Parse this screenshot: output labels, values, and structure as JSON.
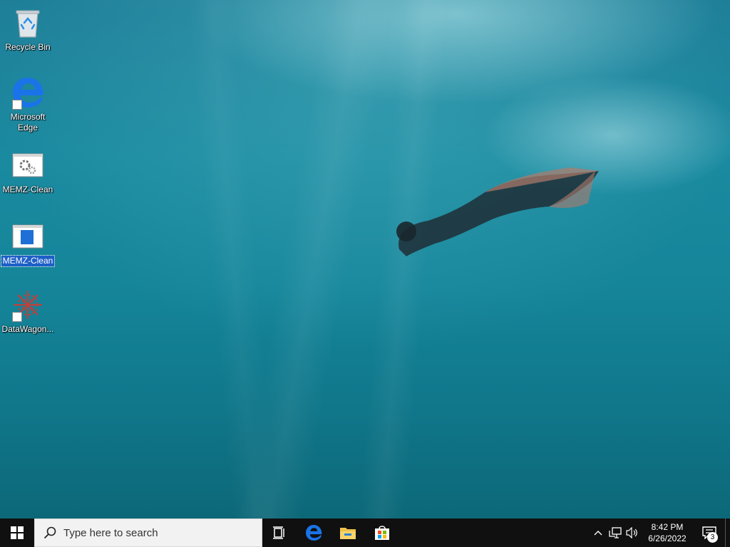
{
  "desktop": {
    "icons": [
      {
        "label": "Recycle Bin",
        "icon": "recycle-bin-icon"
      },
      {
        "label": "Microsoft Edge",
        "icon": "edge-icon"
      },
      {
        "label": "MEMZ-Clean",
        "icon": "gear-app-icon"
      },
      {
        "label": "MEMZ-Clean",
        "icon": "window-app-icon",
        "selected": true
      },
      {
        "label": "DataWagon...",
        "icon": "datawagon-icon"
      }
    ]
  },
  "taskbar": {
    "search_placeholder": "Type here to search",
    "pinned": [
      "task-view-icon",
      "edge-icon",
      "file-explorer-icon",
      "store-icon"
    ],
    "tray": {
      "time": "8:42 PM",
      "date": "6/26/2022",
      "notification_count": "3"
    }
  },
  "colors": {
    "taskbar": "#101010",
    "selection": "#1e5fc8",
    "edge_blue": "#1a73e8"
  }
}
